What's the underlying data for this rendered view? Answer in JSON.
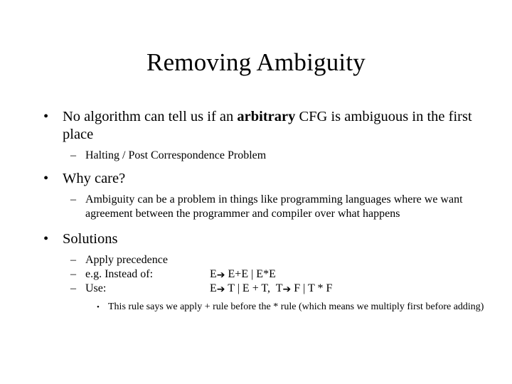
{
  "slide": {
    "title": "Removing Ambiguity",
    "bullets": [
      {
        "level": 1,
        "marker": "•",
        "text_before_bold": "No algorithm can tell us if an ",
        "bold": "arbitrary",
        "text_after_bold": " CFG is ambiguous in the first place"
      },
      {
        "level": 2,
        "marker": "–",
        "text": "Halting / Post Correspondence Problem"
      },
      {
        "level": 1,
        "marker": "•",
        "text": "Why care?"
      },
      {
        "level": 2,
        "marker": "–",
        "text": "Ambiguity can be a problem in things like programming languages where we want agreement between the programmer and compiler over what happens"
      },
      {
        "level": 1,
        "marker": "•",
        "text": "Solutions"
      },
      {
        "level": 2,
        "marker": "–",
        "text": "Apply precedence"
      },
      {
        "level": 2,
        "marker": "–",
        "label": "e.g.  Instead of:",
        "rule_lhs": "E",
        "arrow": "➔",
        "rule_rhs": " E+E | E*E"
      },
      {
        "level": 2,
        "marker": "–",
        "label": "Use:",
        "rule_lhs": "E",
        "arrow": "➔",
        "rule_rhs": " T | E + T,  T",
        "arrow2": "➔",
        "rule_rhs2": " F | T * F"
      },
      {
        "level": 3,
        "marker": "•",
        "text": "This rule says we apply + rule before the * rule (which means we multiply first before adding)"
      }
    ]
  },
  "colors": {
    "background": "#ffffff",
    "text": "#000000"
  }
}
